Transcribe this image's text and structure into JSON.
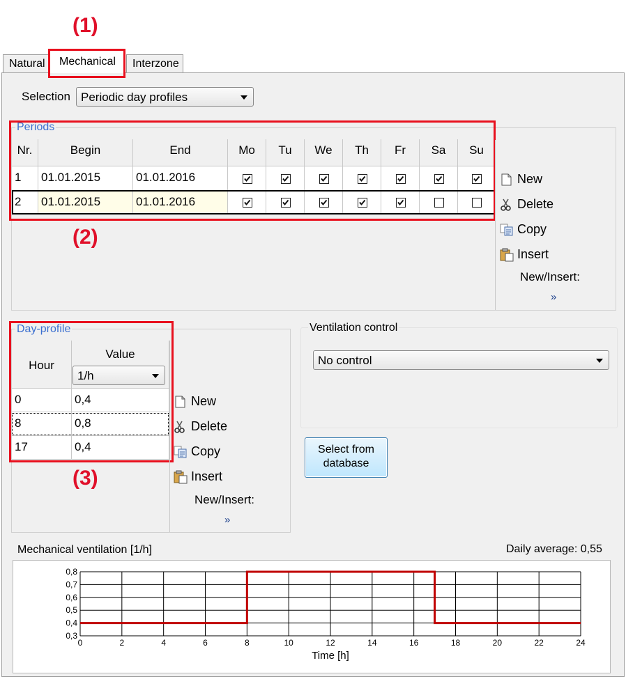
{
  "annotations": {
    "a1": "(1)",
    "a2": "(2)",
    "a3": "(3)"
  },
  "tabs": [
    "Natural",
    "Mechanical",
    "Interzone"
  ],
  "selection": {
    "label": "Selection",
    "value": "Periodic day profiles"
  },
  "periods": {
    "title": "Periods",
    "headers": [
      "Nr.",
      "Begin",
      "End",
      "Mo",
      "Tu",
      "We",
      "Th",
      "Fr",
      "Sa",
      "Su"
    ],
    "rows": [
      {
        "nr": "1",
        "begin": "01.01.2015",
        "end": "01.01.2016",
        "days": [
          true,
          true,
          true,
          true,
          true,
          true,
          true
        ]
      },
      {
        "nr": "2",
        "begin": "01.01.2015",
        "end": "01.01.2016",
        "days": [
          true,
          true,
          true,
          true,
          true,
          false,
          false
        ]
      }
    ],
    "commands": {
      "new": "New",
      "delete": "Delete",
      "copy": "Copy",
      "insert": "Insert",
      "new_insert": "New/Insert:",
      "more": "»"
    }
  },
  "day_profile": {
    "title": "Day-profile",
    "hour_header": "Hour",
    "value_header": "Value",
    "unit": "1/h",
    "rows": [
      {
        "hour": "0",
        "value": "0,4"
      },
      {
        "hour": "8",
        "value": "0,8"
      },
      {
        "hour": "17",
        "value": "0,4"
      }
    ],
    "commands": {
      "new": "New",
      "delete": "Delete",
      "copy": "Copy",
      "insert": "Insert",
      "new_insert": "New/Insert:",
      "more": "»"
    }
  },
  "ventilation_control": {
    "title": "Ventilation control",
    "value": "No control"
  },
  "select_db_button": {
    "line1": "Select from",
    "line2": "database"
  },
  "chart_title": "Mechanical ventilation [1/h]",
  "daily_average": "Daily average: 0,55",
  "colors": {
    "accent_red": "#e8101e",
    "line": "#c00000",
    "legend_blue": "#3b6fd0"
  },
  "chart_data": {
    "type": "line",
    "title": "Mechanical ventilation [1/h]",
    "xlabel": "Time [h]",
    "ylabel": "",
    "xlim": [
      0,
      24
    ],
    "ylim": [
      0.3,
      0.8
    ],
    "xticks": [
      "0",
      "2",
      "4",
      "6",
      "8",
      "10",
      "12",
      "14",
      "16",
      "18",
      "20",
      "22",
      "24"
    ],
    "yticks": [
      "0,3",
      "0,4",
      "0,5",
      "0,6",
      "0,7",
      "0,8"
    ],
    "grid": true,
    "series": [
      {
        "step": true,
        "x": [
          0,
          8,
          8,
          17,
          17,
          24
        ],
        "y": [
          0.4,
          0.4,
          0.8,
          0.8,
          0.4,
          0.4
        ]
      }
    ]
  }
}
